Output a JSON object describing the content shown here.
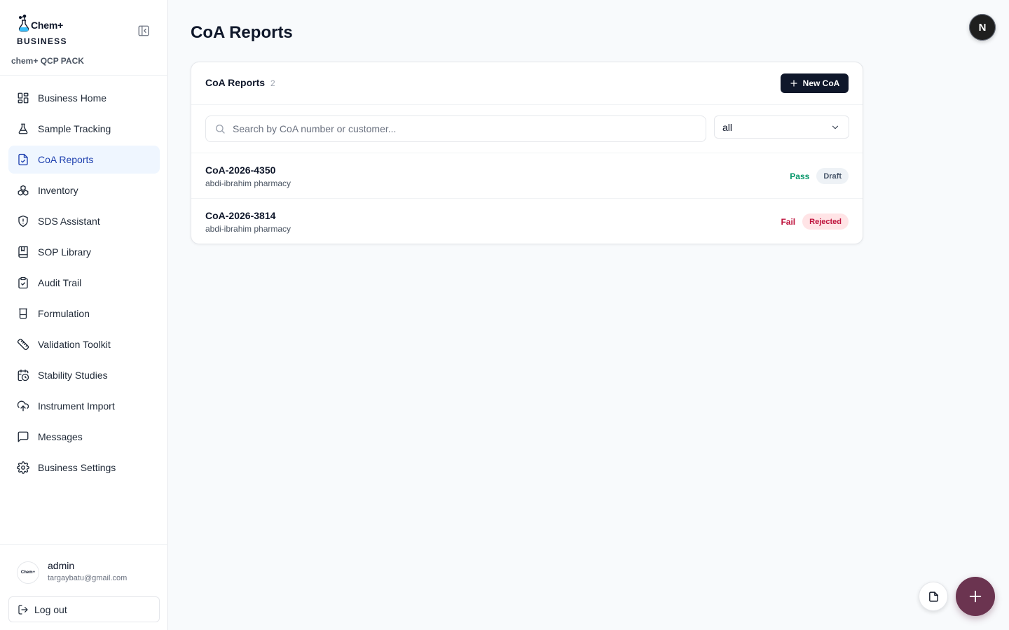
{
  "brand": {
    "name": "Chem+",
    "tier": "BUSINESS",
    "pack": "chem+ QCP PACK"
  },
  "sidebar": {
    "items": [
      {
        "label": "Business Home",
        "icon": "grid-icon"
      },
      {
        "label": "Sample Tracking",
        "icon": "flask-icon"
      },
      {
        "label": "CoA Reports",
        "icon": "file-check-icon",
        "active": true
      },
      {
        "label": "Inventory",
        "icon": "boxes-icon"
      },
      {
        "label": "SDS Assistant",
        "icon": "shield-icon"
      },
      {
        "label": "SOP Library",
        "icon": "book-icon"
      },
      {
        "label": "Audit Trail",
        "icon": "clipboard-check-icon"
      },
      {
        "label": "Formulation",
        "icon": "beaker-icon"
      },
      {
        "label": "Validation Toolkit",
        "icon": "ruler-icon"
      },
      {
        "label": "Stability Studies",
        "icon": "calendar-clock-icon"
      },
      {
        "label": "Instrument Import",
        "icon": "cloud-upload-icon"
      },
      {
        "label": "Messages",
        "icon": "message-square-icon"
      },
      {
        "label": "Business Settings",
        "icon": "gear-icon"
      }
    ]
  },
  "user": {
    "name": "admin",
    "email": "targaybatu@gmail.com",
    "avatar_text": "Chem+",
    "logout_label": "Log out"
  },
  "header": {
    "title": "CoA Reports",
    "profile_initial": "N"
  },
  "card": {
    "title": "CoA Reports",
    "count": "2",
    "new_button": "New CoA",
    "search_placeholder": "Search by CoA number or customer...",
    "filter_value": "all",
    "reports": [
      {
        "number": "CoA-2026-4350",
        "customer": "abdi-ibrahim pharmacy",
        "result": "Pass",
        "status": "Draft"
      },
      {
        "number": "CoA-2026-3814",
        "customer": "abdi-ibrahim pharmacy",
        "result": "Fail",
        "status": "Rejected"
      }
    ]
  },
  "colors": {
    "accent_dark": "#0f172a",
    "active_nav_bg": "#eff6ff",
    "pass": "#059669",
    "fail": "#be123c",
    "fab": "#6b3450"
  }
}
